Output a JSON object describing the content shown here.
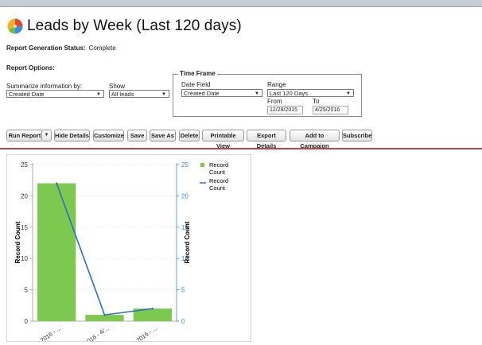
{
  "page": {
    "title": "Leads by Week (Last 120 days)",
    "status_label": "Report Generation Status:",
    "status_value": "Complete",
    "options_label": "Report Options:"
  },
  "options": {
    "summarize_label": "Summarize information by:",
    "summarize_value": "Created Date",
    "show_label": "Show",
    "show_value": "All leads"
  },
  "timeframe": {
    "legend": "Time Frame",
    "date_field_label": "Date Field",
    "date_field_value": "Created Date",
    "range_label": "Range",
    "range_value": "Last 120 Days",
    "from_label": "From",
    "from_value": "12/28/2015",
    "to_label": "To",
    "to_value": "4/25/2016"
  },
  "toolbar": {
    "run_report": "Run Report",
    "run_dropdown": "▼",
    "hide_details": "Hide Details",
    "customize": "Customize",
    "save": "Save",
    "save_as": "Save As",
    "delete": "Delete",
    "printable_view": "Printable View",
    "export_details": "Export Details",
    "add_to_campaign": "Add to Campaign",
    "subscribe": "Subscribe"
  },
  "colors": {
    "bar": "#7dc84f",
    "line": "#2f6fc1",
    "right_axis": "#3a8fd8"
  },
  "chart_data": {
    "type": "bar",
    "categories": [
      "2016 - ...",
      "2016 - 4/...",
      "2016 - ..."
    ],
    "series": [
      {
        "name": "Record Count",
        "kind": "bar",
        "values": [
          22,
          1,
          2
        ]
      },
      {
        "name": "Record Count",
        "kind": "line",
        "values": [
          22,
          1,
          2
        ]
      }
    ],
    "ylabel": "Record Count",
    "ylabel_right": "Record Count",
    "ylim": [
      0,
      25
    ],
    "yticks": [
      0,
      5,
      10,
      15,
      20,
      25
    ],
    "grid": true,
    "legend_position": "top-right"
  }
}
